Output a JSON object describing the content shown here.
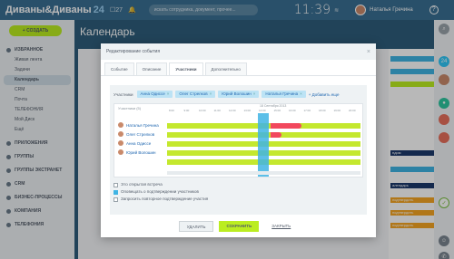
{
  "topbar": {
    "logo": "Диваны&Диваны",
    "logo_num": "24",
    "icon_counter": "27",
    "search_placeholder": "искать сотрудника, документ, прочее...",
    "clock": "11:39",
    "user_name": "Наталья Гречина",
    "help": "?"
  },
  "sidebar": {
    "create_label": "СОЗДАТЬ",
    "items": [
      {
        "label": "ИЗБРАННОЕ",
        "type": "sec"
      },
      {
        "label": "Живая лента",
        "type": "item"
      },
      {
        "label": "Задачи",
        "type": "item"
      },
      {
        "label": "Календарь",
        "type": "active"
      },
      {
        "label": "CRM",
        "type": "item"
      },
      {
        "label": "Почта",
        "type": "item"
      },
      {
        "label": "ТЕЛЕФОНИЯ",
        "type": "item"
      },
      {
        "label": "Мой Диск",
        "type": "item"
      },
      {
        "label": "Ещё",
        "type": "item"
      },
      {
        "label": "ПРИЛОЖЕНИЯ",
        "type": "sec"
      },
      {
        "label": "ГРУППЫ",
        "type": "sec"
      },
      {
        "label": "ГРУППЫ ЭКСТРАНЕТ",
        "type": "sec"
      },
      {
        "label": "CRM",
        "type": "sec"
      },
      {
        "label": "БИЗНЕС-ПРОЦЕССЫ",
        "type": "sec"
      },
      {
        "label": "КОМПАНИЯ",
        "type": "sec"
      },
      {
        "label": "ТЕЛЕФОНИЯ",
        "type": "sec"
      }
    ]
  },
  "main": {
    "title": "Календарь"
  },
  "right_col": {
    "bars": [
      {
        "label": "",
        "color": "#3fb4e4"
      },
      {
        "label": "",
        "color": "#3fb4e4"
      },
      {
        "label": "",
        "color": "#bbed21"
      },
      {
        "label": "ндом",
        "color": "#1d3a6b"
      },
      {
        "label": "",
        "color": "#3fb4e4"
      },
      {
        "label": "алендарь",
        "color": "#1d3a6b"
      },
      {
        "label": "подтвердить",
        "color": "#f5a623"
      },
      {
        "label": "подтвердить",
        "color": "#f5a623"
      },
      {
        "label": "подтвердить",
        "color": "#f5a623"
      }
    ]
  },
  "rail": {
    "counter": "24"
  },
  "dialog": {
    "title": "Редактирование события",
    "tabs": [
      "Событие",
      "Описание",
      "Участники",
      "Дополнительно"
    ],
    "active_tab": 2,
    "attendees_label": "Участники",
    "chips": [
      "Анна Одиссе",
      "Олег Стрелков",
      "Юрий Волошин",
      "Наталья Гречина"
    ],
    "add_more": "+ Добавить еще",
    "grid": {
      "header_label": "Участники (5)",
      "date": "18 Сентября 2013",
      "times": [
        "8:00",
        "9:00",
        "10:00",
        "11:00",
        "12:00",
        "13:00",
        "14:00",
        "15:00",
        "16:00",
        "17:00",
        "18:00",
        "19:00",
        "20:00"
      ],
      "people": [
        "Наталья Гречина",
        "Олег Стрелков",
        "Анна Одиссе",
        "Юрий Волошин"
      ],
      "colors": {
        "free": "#c4e82e",
        "busy": "#f2485d",
        "selection": "#3fb4e4"
      }
    },
    "options": [
      {
        "label": "Это открытая встреча",
        "checked": false
      },
      {
        "label": "Оповещать о подтверждении участников",
        "checked": true
      },
      {
        "label": "Запросить повторное подтверждение участия",
        "checked": false
      }
    ],
    "buttons": {
      "delete": "УДАЛИТЬ",
      "save": "СОХРАНИТЬ",
      "close": "ЗАКРЫТЬ"
    }
  }
}
